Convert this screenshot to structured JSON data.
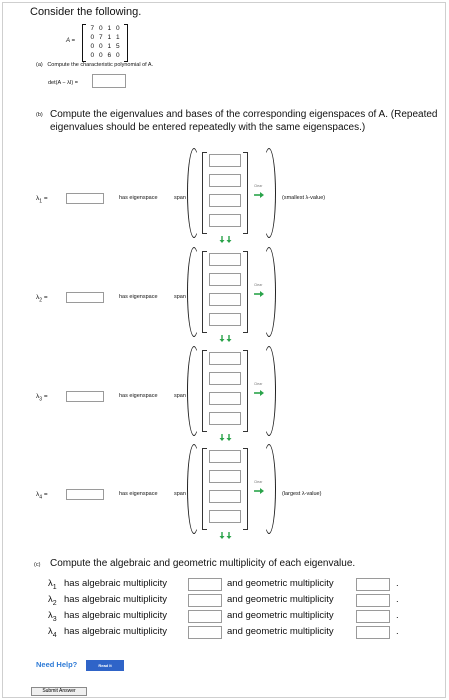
{
  "intro": "Consider the following.",
  "matrix": {
    "label": "A =",
    "rows": [
      [
        "7",
        "0",
        "1",
        "0"
      ],
      [
        "0",
        "7",
        "1",
        "1"
      ],
      [
        "0",
        "0",
        "1",
        "5"
      ],
      [
        "0",
        "0",
        "6",
        "0"
      ]
    ]
  },
  "part_a": {
    "letter": "(a)",
    "prompt": "Compute the characteristic polynomial of A.",
    "det_label": "det(A − λI) ="
  },
  "part_b": {
    "letter": "(b)",
    "prompt": "Compute the eigenvalues and bases of the corresponding eigenspaces of A. (Repeated eigenvalues should be entered repeatedly with the same eigenspaces.)",
    "rows": [
      {
        "lambda": "λ",
        "sub": "1",
        "eq": "=",
        "has_eigenspace": "has eigenspace",
        "span": "span",
        "note": "(smallest λ-value)"
      },
      {
        "lambda": "λ",
        "sub": "2",
        "eq": "=",
        "has_eigenspace": "has eigenspace",
        "span": "span",
        "note": ""
      },
      {
        "lambda": "λ",
        "sub": "3",
        "eq": "=",
        "has_eigenspace": "has eigenspace",
        "span": "span",
        "note": ""
      },
      {
        "lambda": "λ",
        "sub": "4",
        "eq": "=",
        "has_eigenspace": "has eigenspace",
        "span": "span",
        "note": "(largest λ-value)"
      }
    ],
    "clear_label": "Clear"
  },
  "part_c": {
    "letter": "(c)",
    "prompt": "Compute the algebraic and geometric multiplicity of each eigenvalue.",
    "rows": [
      {
        "lambda": "λ",
        "sub": "1",
        "alg": "has algebraic multiplicity",
        "geo": "and geometric multiplicity",
        "end": "."
      },
      {
        "lambda": "λ",
        "sub": "2",
        "alg": "has algebraic multiplicity",
        "geo": "and geometric multiplicity",
        "end": "."
      },
      {
        "lambda": "λ",
        "sub": "3",
        "alg": "has algebraic multiplicity",
        "geo": "and geometric multiplicity",
        "end": "."
      },
      {
        "lambda": "λ",
        "sub": "4",
        "alg": "has algebraic multiplicity",
        "geo": "and geometric multiplicity",
        "end": "."
      }
    ]
  },
  "help": {
    "label": "Need Help?",
    "read_it": "Read It"
  },
  "submit_label": "Submit Answer",
  "colors": {
    "help_text": "#2f7bd6",
    "read_it_bg": "#2f64c8",
    "arrow_green": "#2aa34a"
  }
}
